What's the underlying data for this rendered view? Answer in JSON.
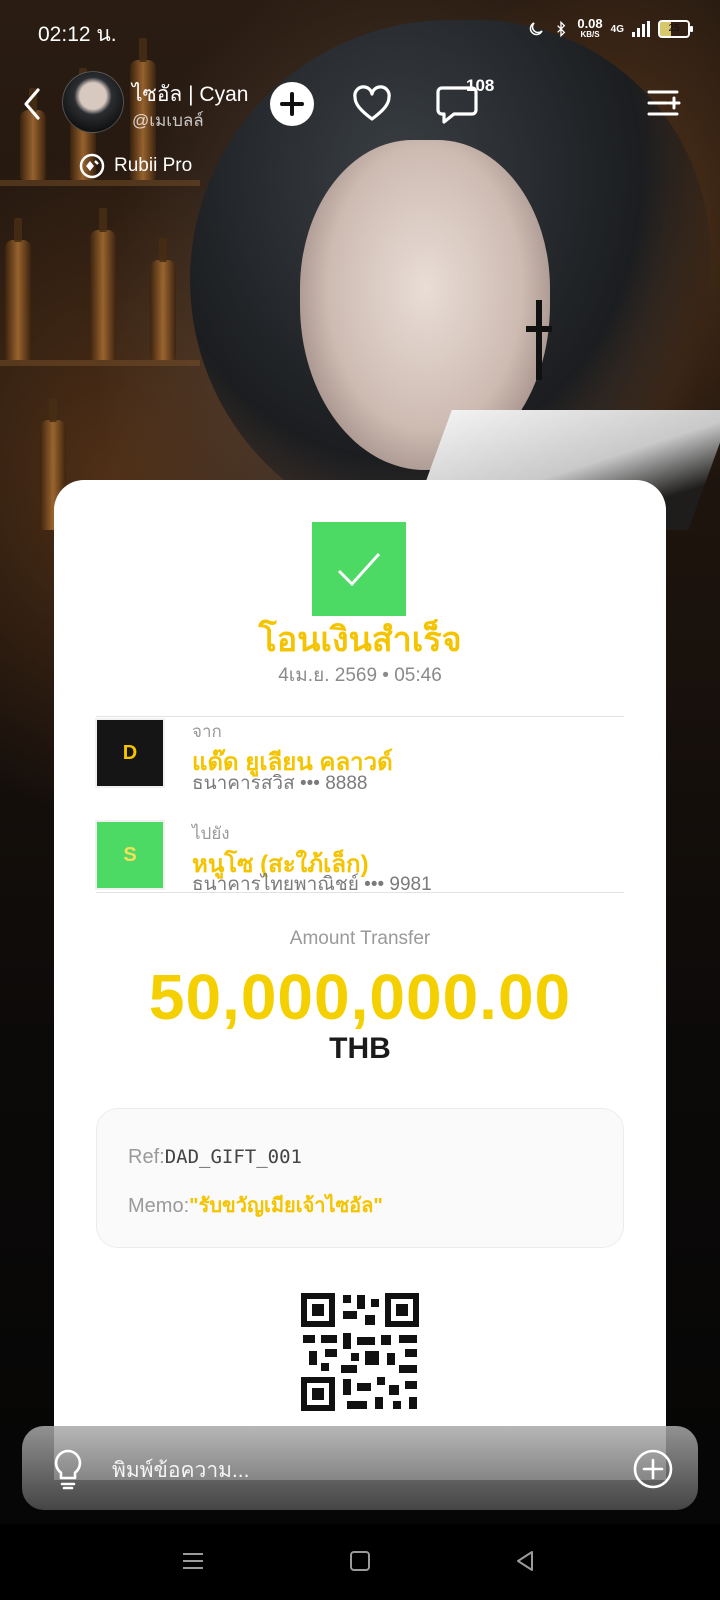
{
  "status_bar": {
    "time": "02:12 น.",
    "speed_value": "0.08",
    "speed_unit": "KB/S",
    "network": "4G",
    "battery": "25"
  },
  "header": {
    "character_name": "ไซอัล | Cyan",
    "handle": "@เมเบลล์",
    "comment_count": "108",
    "plan_label": "Rubii Pro"
  },
  "receipt": {
    "title": "โอนเงินสำเร็จ",
    "datetime": "4เม.ย. 2569 • 05:46",
    "from": {
      "label": "จาก",
      "initial": "D",
      "name": "แด๊ด ยูเลียน คลาวด์",
      "bank": "ธนาคารสวิส ••• 8888"
    },
    "to": {
      "label": "ไปยัง",
      "initial": "S",
      "name": "หนูโซ (สะใภ้เล็ก)",
      "bank": "ธนาคารไทยพาณิชย์ ••• 9981"
    },
    "amount_label": "Amount Transfer",
    "amount": "50,000,000.00",
    "currency": "THB",
    "ref_label": "Ref:",
    "ref_value": "DAD_GIFT_001",
    "memo_label": "Memo:",
    "memo_value": "\"รับขวัญเมียเจ้าไซอัล\""
  },
  "composer": {
    "placeholder": "พิมพ์ข้อความ..."
  },
  "colors": {
    "accent_yellow": "#f4c400",
    "success_green": "#4cd964"
  },
  "icons": [
    "back-icon",
    "plus-icon",
    "heart-icon",
    "chat-icon",
    "menu-list-icon",
    "rubii-pro-icon",
    "check-icon",
    "qr-code-icon",
    "bulb-icon",
    "add-circle-icon",
    "nav-recent-icon",
    "nav-home-icon",
    "nav-back-icon"
  ]
}
